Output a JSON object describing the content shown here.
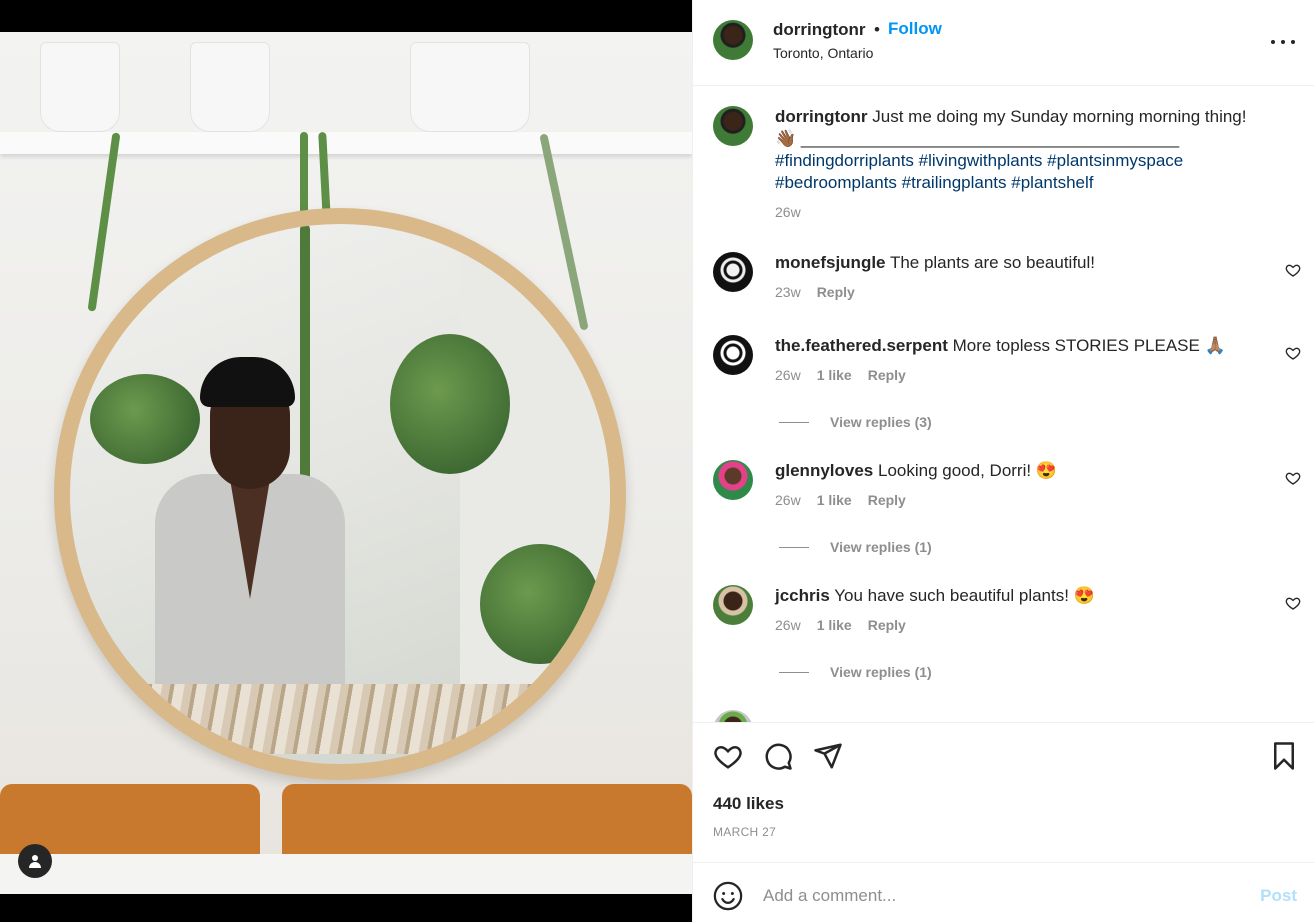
{
  "header": {
    "username": "dorringtonr",
    "separator": "•",
    "follow_label": "Follow",
    "location": "Toronto, Ontario"
  },
  "caption": {
    "username": "dorringtonr",
    "text": "Just me doing my Sunday morning morning thing!",
    "emoji": "👋🏾",
    "divider": "________________________________________",
    "hashtags_line1": "#findingdorriplants #livingwithplants #plantsinmyspace",
    "hashtags_line2": "#bedroomplants #trailingplants #plantshelf",
    "time": "26w"
  },
  "comments": [
    {
      "username": "monefsjungle",
      "text": "The plants are so beautiful!",
      "time": "23w",
      "likes": "",
      "reply": "Reply",
      "view_replies": ""
    },
    {
      "username": "the.feathered.serpent",
      "text": "More topless STORIES PLEASE 🙏🏽",
      "time": "26w",
      "likes": "1 like",
      "reply": "Reply",
      "view_replies": "View replies (3)"
    },
    {
      "username": "glennyloves",
      "text": "Looking good, Dorri! 😍",
      "time": "26w",
      "likes": "1 like",
      "reply": "Reply",
      "view_replies": "View replies (1)"
    },
    {
      "username": "jcchris",
      "text": "You have such beautiful plants! 😍",
      "time": "26w",
      "likes": "1 like",
      "reply": "Reply",
      "view_replies": "View replies (1)"
    }
  ],
  "actions": {
    "likes": "440 likes",
    "date": "MARCH 27"
  },
  "add_comment": {
    "placeholder": "Add a comment...",
    "post_label": "Post"
  },
  "icons": {
    "more": "more-horizontal-icon",
    "like": "heart-icon",
    "comment": "comment-bubble-icon",
    "share": "paper-plane-icon",
    "save": "bookmark-icon",
    "emoji": "smiley-icon",
    "tag": "user-tag-icon"
  },
  "colors": {
    "link_blue": "#0095f6",
    "hashtag_blue": "#00376b",
    "muted": "#8e8e8e",
    "post_disabled": "#b2dffc"
  }
}
